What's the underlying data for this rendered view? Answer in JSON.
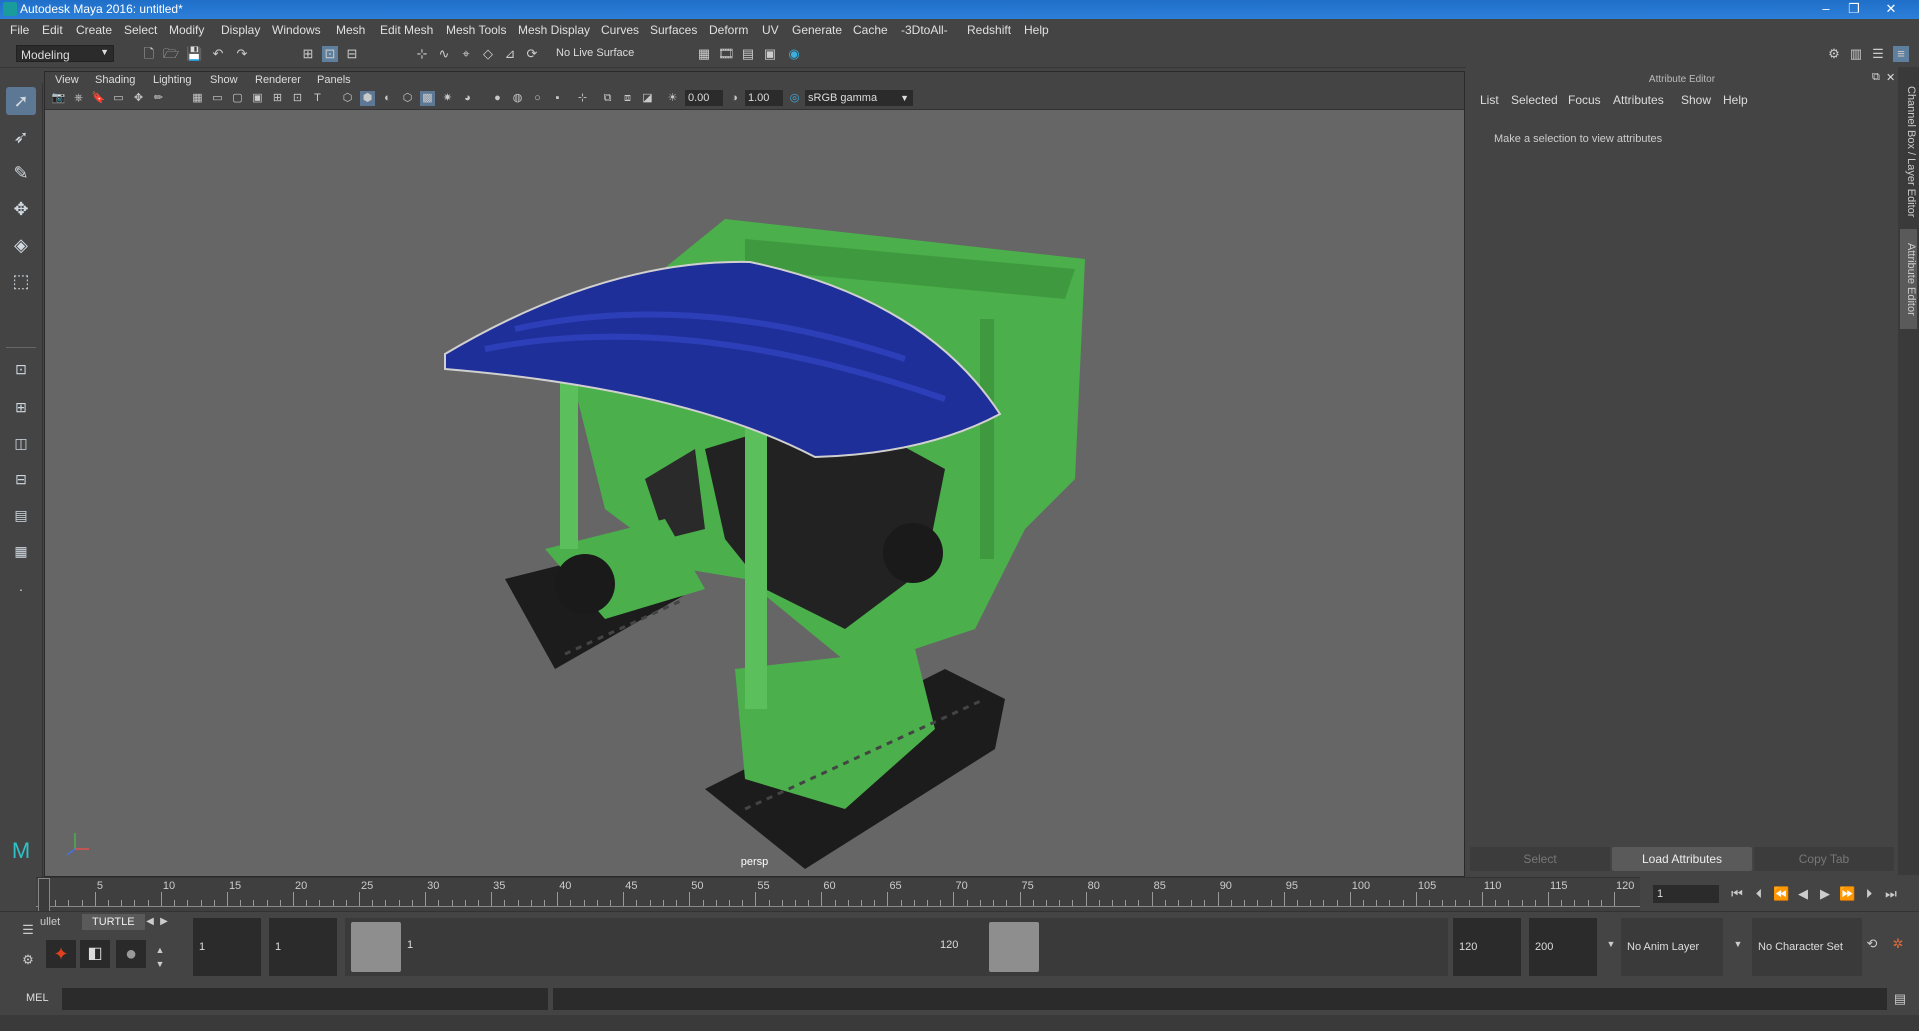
{
  "window": {
    "title": "Autodesk Maya 2016: untitled*"
  },
  "menus": [
    "File",
    "Edit",
    "Create",
    "Select",
    "Modify",
    "Display",
    "Windows",
    "Mesh",
    "Edit Mesh",
    "Mesh Tools",
    "Mesh Display",
    "Curves",
    "Surfaces",
    "Deform",
    "UV",
    "Generate",
    "Cache",
    "-3DtoAll-",
    "Redshift",
    "Help"
  ],
  "statusline": {
    "mode": "Modeling",
    "live_surface": "No Live Surface"
  },
  "viewport": {
    "menus": [
      "View",
      "Shading",
      "Lighting",
      "Show",
      "Renderer",
      "Panels"
    ],
    "exposure": "0.00",
    "gamma": "1.00",
    "colorspace": "sRGB gamma",
    "camera_label": "persp"
  },
  "attribute_editor": {
    "title": "Attribute Editor",
    "menus": [
      "List",
      "Selected",
      "Focus",
      "Attributes",
      "Show",
      "Help"
    ],
    "message": "Make a selection to view attributes",
    "buttons": {
      "select": "Select",
      "load": "Load Attributes",
      "copy": "Copy Tab"
    }
  },
  "side_tabs": {
    "channel_box": "Channel Box / Layer Editor",
    "attribute_editor": "Attribute Editor"
  },
  "timeline": {
    "ticks": [
      1,
      5,
      10,
      15,
      20,
      25,
      30,
      35,
      40,
      45,
      50,
      55,
      60,
      65,
      70,
      75,
      80,
      85,
      90,
      95,
      100,
      105,
      110,
      115,
      120
    ],
    "current_frame": "1"
  },
  "shelf": {
    "tabs": [
      "ullet",
      "TURTLE"
    ]
  },
  "range": {
    "start": "1",
    "playback_start": "1",
    "slider_start": "1",
    "slider_end": "120",
    "playback_end": "120",
    "end": "200",
    "anim_layer": "No Anim Layer",
    "character_set": "No Character Set"
  },
  "command_line": {
    "language": "MEL"
  },
  "colors": {
    "titlebar": "#2c7fd8",
    "ui_bg": "#444444",
    "viewport_bg": "#666666",
    "model_green": "#4bb04b",
    "canopy_blue": "#1f2f9a"
  }
}
